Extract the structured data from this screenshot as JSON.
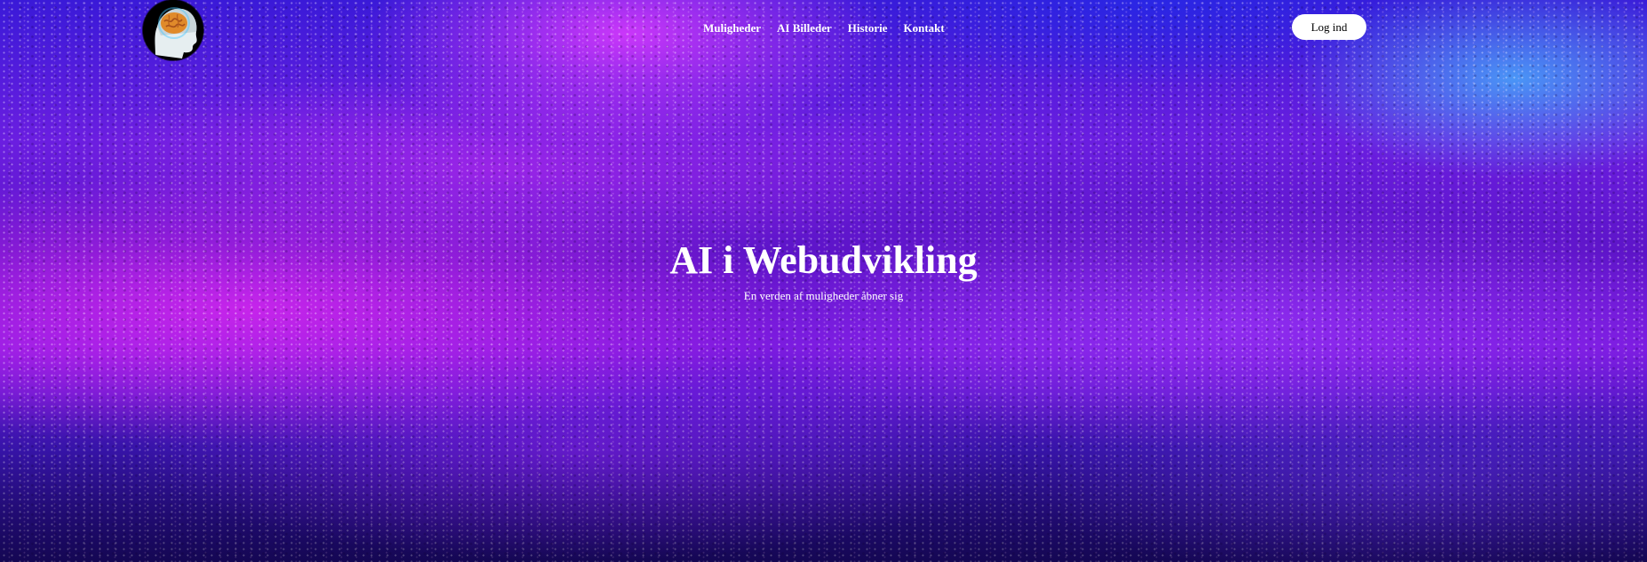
{
  "header": {
    "logo_icon": "brain-head-icon",
    "nav": [
      {
        "label": "Muligheder"
      },
      {
        "label": "AI Billeder"
      },
      {
        "label": "Historie"
      },
      {
        "label": "Kontakt"
      }
    ],
    "login_label": "Log ind"
  },
  "hero": {
    "title": "AI i Webudvikling",
    "subtitle": "En verden af muligheder åbner sig",
    "background_colors": [
      "#3a1ad8",
      "#c83cf0",
      "#46beff",
      "#1a0a6a"
    ]
  }
}
